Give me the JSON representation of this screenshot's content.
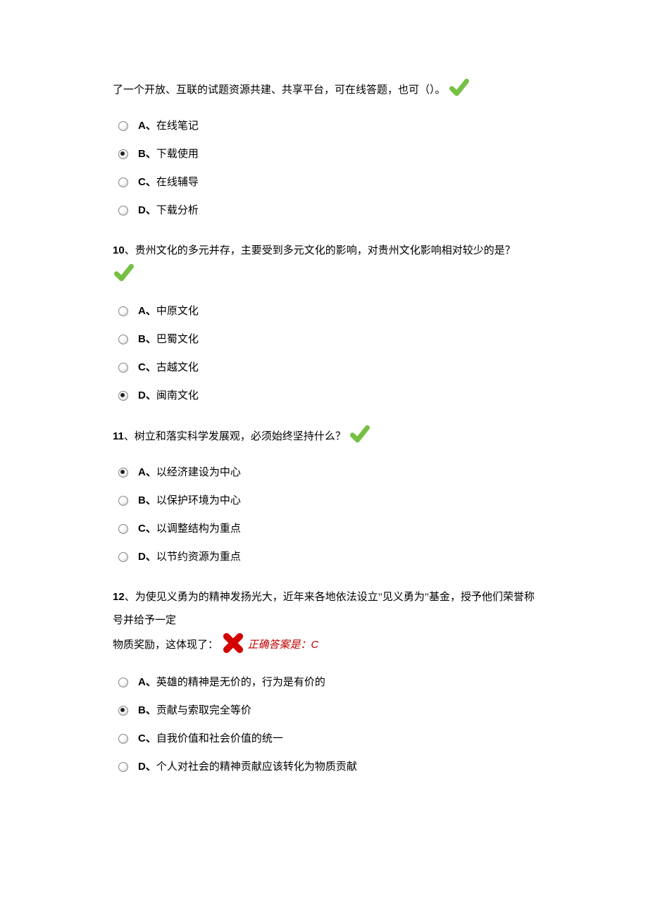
{
  "q9": {
    "textline": "了一个开放、互联的试题资源共建、共享平台，可在线答题，也可（）。",
    "options": [
      {
        "letter": "A、",
        "text": "在线笔记",
        "selected": false
      },
      {
        "letter": "B、",
        "text": "下载使用",
        "selected": true
      },
      {
        "letter": "C、",
        "text": "在线辅导",
        "selected": false
      },
      {
        "letter": "D、",
        "text": "下载分析",
        "selected": false
      }
    ]
  },
  "q10": {
    "number": "10",
    "punct": "、",
    "text": "贵州文化的多元并存，主要受到多元文化的影响，对贵州文化影响相对较少的是？",
    "options": [
      {
        "letter": "A、",
        "text": "中原文化",
        "selected": false
      },
      {
        "letter": "B、",
        "text": "巴蜀文化",
        "selected": false
      },
      {
        "letter": "C、",
        "text": "古越文化",
        "selected": false
      },
      {
        "letter": "D、",
        "text": "闽南文化",
        "selected": true
      }
    ]
  },
  "q11": {
    "number": "11",
    "punct": "、",
    "text": "树立和落实科学发展观，必须始终坚持什么？",
    "options": [
      {
        "letter": "A、",
        "text": "以经济建设为中心",
        "selected": true
      },
      {
        "letter": "B、",
        "text": "以保护环境为中心",
        "selected": false
      },
      {
        "letter": "C、",
        "text": "以调整结构为重点",
        "selected": false
      },
      {
        "letter": "D、",
        "text": "以节约资源为重点",
        "selected": false
      }
    ]
  },
  "q12": {
    "number": "12",
    "punct": "、",
    "text_line1": "为使见义勇为的精神发扬光大，近年来各地依法设立\"见义勇为\"基金，授予他们荣誉称号并给予一定",
    "text_line2": "物质奖励，这体现了：",
    "correct_prefix": "正确答案是：",
    "correct_letter": "C",
    "options": [
      {
        "letter": "A、",
        "text": "英雄的精神是无价的，行为是有价的",
        "selected": false
      },
      {
        "letter": "B、",
        "text": "贡献与索取完全等价",
        "selected": true
      },
      {
        "letter": "C、",
        "text": "自我价值和社会价值的统一",
        "selected": false
      },
      {
        "letter": "D、",
        "text": "个人对社会的精神贡献应该转化为物质贡献",
        "selected": false
      }
    ]
  }
}
